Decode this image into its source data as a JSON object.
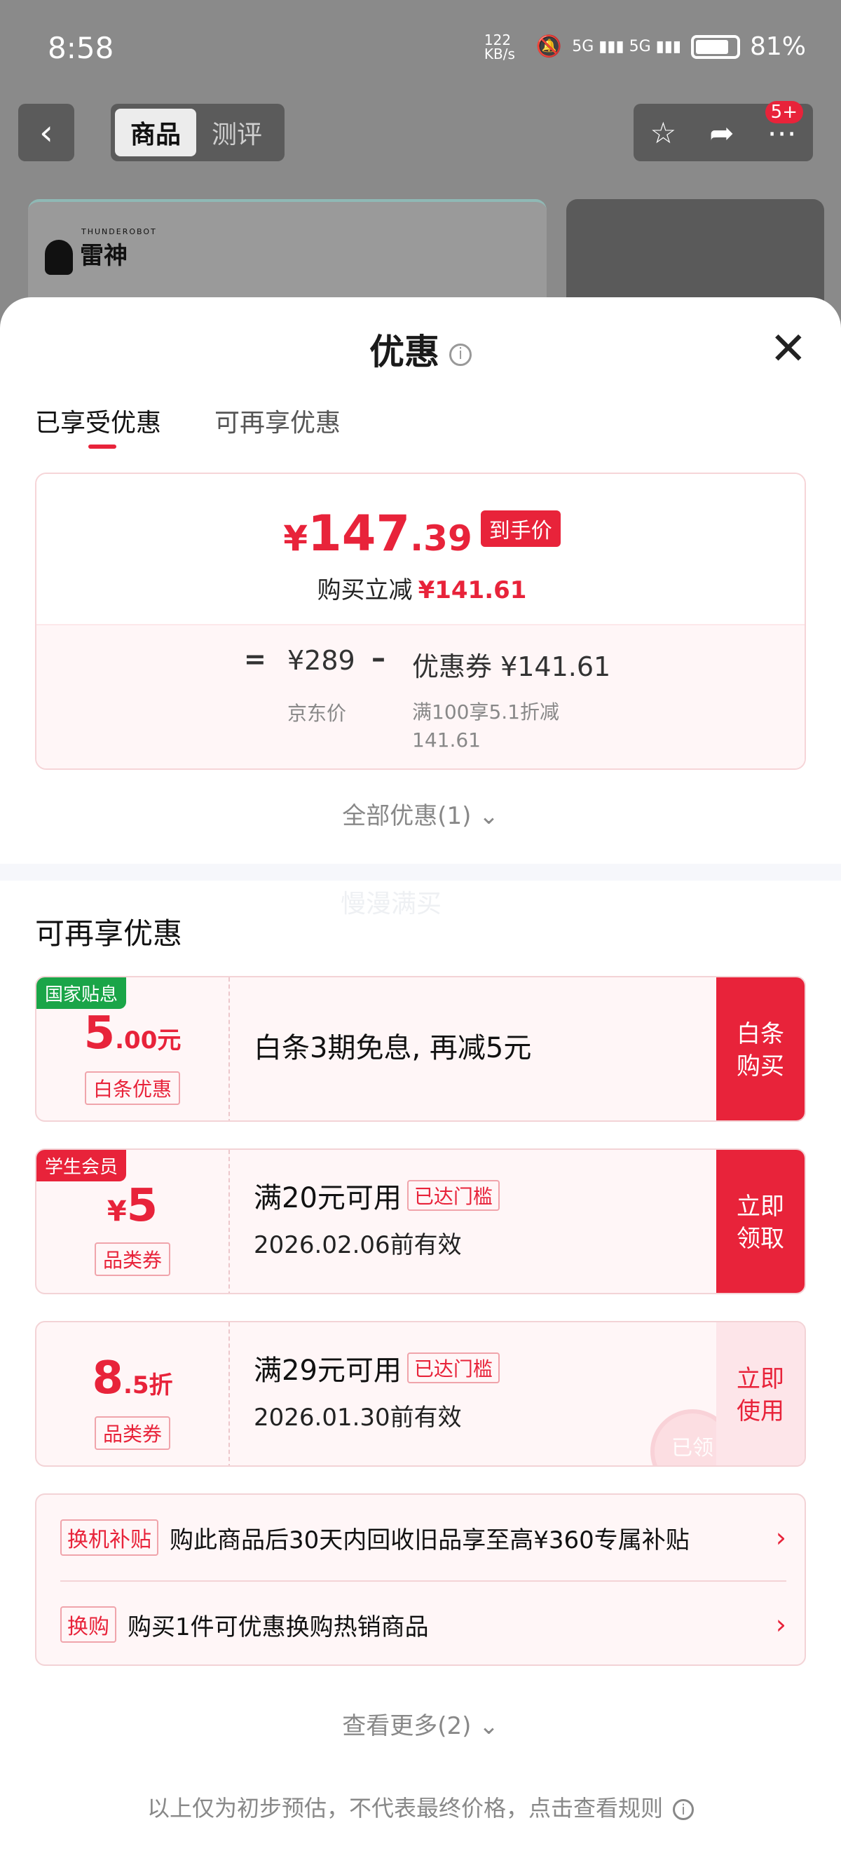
{
  "status": {
    "time": "8:58",
    "net": "122 KB/s",
    "signal": "5G ▮▮▮ 5G ▮▮▮",
    "battery": "81%"
  },
  "nav": {
    "back": "‹",
    "tab_active": "商品",
    "tab_other": "测评",
    "badge": "5+"
  },
  "product": {
    "brand_en": "THUNDEROBOT",
    "brand_cn": "雷神"
  },
  "sheet": {
    "title": "优惠",
    "close": "✕"
  },
  "tabs": {
    "enjoyed": "已享受优惠",
    "more": "可再享优惠"
  },
  "price": {
    "yen": "¥",
    "integer": "147",
    "decimal": ".39",
    "tag": "到手价",
    "reduce_label": "购买立减",
    "reduce_value": "¥141.61"
  },
  "formula": {
    "eq": "=",
    "base": "¥289",
    "minus": "–",
    "coupon": "优惠券 ¥141.61",
    "base_label": "京东价",
    "coupon_label": "满100享5.1折减141.61"
  },
  "all_discounts": "全部优惠(1) ⌄",
  "watermark": "慢漫满买",
  "section_title": "可再享优惠",
  "coupons": [
    {
      "badge": "国家贴息",
      "amount": "5",
      "amount_suffix": ".00元",
      "type": "白条优惠",
      "main": "白条3期免息, 再减5元",
      "action": "白条购买"
    },
    {
      "badge": "学生会员",
      "amount_prefix": "¥",
      "amount": "5",
      "type": "品类券",
      "main": "满20元可用",
      "tag": "已达门槛",
      "date": "2026.02.06前有效",
      "action": "立即领取"
    },
    {
      "amount": "8",
      "amount_suffix": ".5折",
      "type": "品类券",
      "main": "满29元可用",
      "tag": "已达门槛",
      "date": "2026.01.30前有效",
      "action": "立即使用",
      "stamp": "已领"
    }
  ],
  "extras": [
    {
      "tag": "换机补贴",
      "text": "购此商品后30天内回收旧品享至高¥360专属补贴",
      "arrow": "›"
    },
    {
      "tag": "换购",
      "text": "购买1件可优惠换购热销商品",
      "arrow": "›"
    }
  ],
  "see_more": "查看更多(2) ⌄",
  "footer": "以上仅为初步预估，不代表最终价格，点击查看规则",
  "colors": {
    "accent": "#e8233a",
    "green": "#1aa548"
  }
}
